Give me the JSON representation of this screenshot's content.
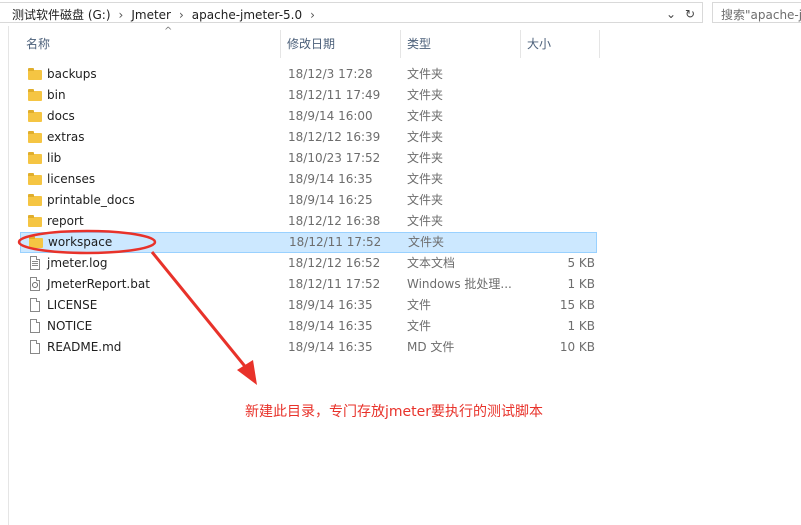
{
  "address_bar": {
    "crumbs": [
      "测试软件磁盘 (G:)",
      "Jmeter",
      "apache-jmeter-5.0"
    ],
    "dropdown_glyph": "⌄",
    "refresh_glyph": "↻"
  },
  "search": {
    "placeholder": "搜索\"apache-j"
  },
  "columns": {
    "name": "名称",
    "date": "修改日期",
    "type": "类型",
    "size": "大小"
  },
  "sort_glyph": "^",
  "files": [
    {
      "name": "backups",
      "date": "18/12/3 17:28",
      "type": "文件夹",
      "size": "",
      "icon": "folder-icon"
    },
    {
      "name": "bin",
      "date": "18/12/11 17:49",
      "type": "文件夹",
      "size": "",
      "icon": "folder-icon"
    },
    {
      "name": "docs",
      "date": "18/9/14 16:00",
      "type": "文件夹",
      "size": "",
      "icon": "folder-icon"
    },
    {
      "name": "extras",
      "date": "18/12/12 16:39",
      "type": "文件夹",
      "size": "",
      "icon": "folder-icon"
    },
    {
      "name": "lib",
      "date": "18/10/23 17:52",
      "type": "文件夹",
      "size": "",
      "icon": "folder-icon"
    },
    {
      "name": "licenses",
      "date": "18/9/14 16:35",
      "type": "文件夹",
      "size": "",
      "icon": "folder-icon"
    },
    {
      "name": "printable_docs",
      "date": "18/9/14 16:25",
      "type": "文件夹",
      "size": "",
      "icon": "folder-icon"
    },
    {
      "name": "report",
      "date": "18/12/12 16:38",
      "type": "文件夹",
      "size": "",
      "icon": "folder-icon"
    },
    {
      "name": "workspace",
      "date": "18/12/11 17:52",
      "type": "文件夹",
      "size": "",
      "icon": "folder-icon"
    },
    {
      "name": "jmeter.log",
      "date": "18/12/12 16:52",
      "type": "文本文档",
      "size": "5 KB",
      "icon": "text-file-icon"
    },
    {
      "name": "JmeterReport.bat",
      "date": "18/12/11 17:52",
      "type": "Windows 批处理...",
      "size": "1 KB",
      "icon": "batch-file-icon"
    },
    {
      "name": "LICENSE",
      "date": "18/9/14 16:35",
      "type": "文件",
      "size": "15 KB",
      "icon": "file-icon"
    },
    {
      "name": "NOTICE",
      "date": "18/9/14 16:35",
      "type": "文件",
      "size": "1 KB",
      "icon": "file-icon"
    },
    {
      "name": "README.md",
      "date": "18/9/14 16:35",
      "type": "MD 文件",
      "size": "10 KB",
      "icon": "file-icon"
    }
  ],
  "selected_index": 8,
  "annotation": {
    "text": "新建此目录，专门存放jmeter要执行的测试脚本",
    "color": "#e8322a"
  },
  "colors": {
    "selection_bg": "#cce8ff",
    "selection_border": "#99d1ff",
    "folder": "#f5c543"
  }
}
